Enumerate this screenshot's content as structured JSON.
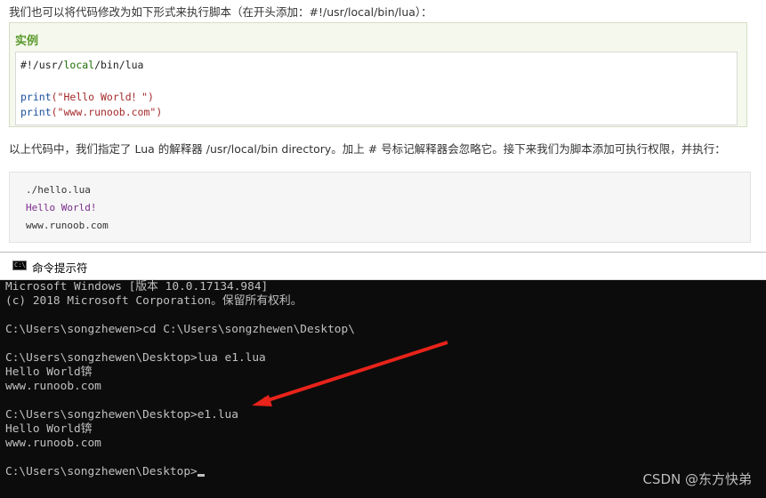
{
  "article": {
    "intro": "我们也可以将代码修改为如下形式来执行脚本（在开头添加：#!/usr/local/bin/lua）：",
    "example_title": "实例",
    "code": {
      "shebang_a": "#!/usr/",
      "shebang_kw": "local",
      "shebang_b": "/bin/lua",
      "print_kw": "print",
      "str1": "(\"Hello World！\")",
      "str2": "(\"www.runoob.com\")"
    },
    "explain": "以上代码中，我们指定了 Lua 的解释器 /usr/local/bin directory。加上 # 号标记解释器会忽略它。接下来我们为脚本添加可执行权限，并执行：",
    "output": {
      "cmd": "./hello.lua",
      "line1": "Hello World!",
      "line2": "www.runoob.com"
    }
  },
  "console": {
    "title": "命令提示符",
    "icon_text": "C:\\",
    "lines": [
      "Microsoft Windows [版本 10.0.17134.984]",
      "(c) 2018 Microsoft Corporation。保留所有权利。",
      "",
      "C:\\Users\\songzhewen>cd C:\\Users\\songzhewen\\Desktop\\",
      "",
      "C:\\Users\\songzhewen\\Desktop>lua e1.lua",
      "Hello World锛",
      "www.runoob.com",
      "",
      "C:\\Users\\songzhewen\\Desktop>e1.lua",
      "Hello World锛",
      "www.runoob.com",
      "",
      "C:\\Users\\songzhewen\\Desktop>"
    ]
  },
  "watermark": "CSDN @东方快弟",
  "colors": {
    "arrow": "#e8231a",
    "example_title": "#5a9a2c"
  },
  "icons": {
    "console": "cmd-icon",
    "annotation": "red-arrow"
  }
}
